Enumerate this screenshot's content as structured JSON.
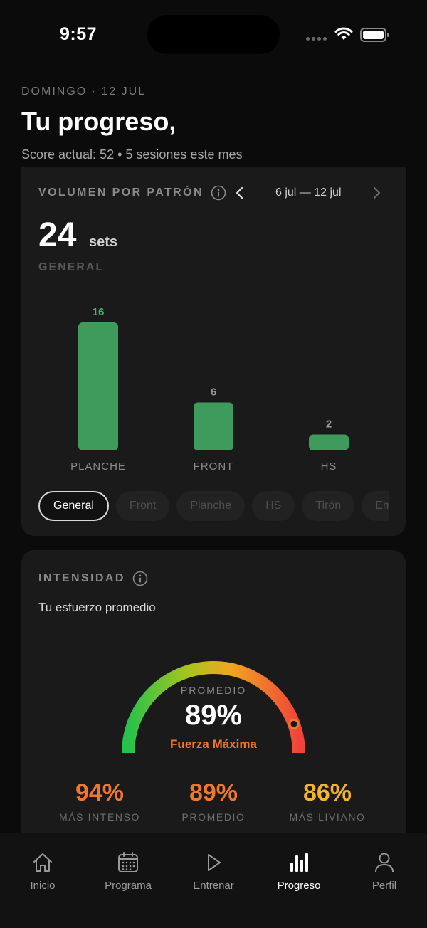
{
  "status_bar": {
    "time": "9:57"
  },
  "header": {
    "date": "DOMINGO · 12 JUL",
    "title": "Tu progreso,",
    "subtitle": "Score actual: 52 • 5 sesiones este mes"
  },
  "volume": {
    "label": "VOLUMEN POR PATRÓN",
    "range": "6 jul — 12 jul",
    "total": "24",
    "unit": "sets",
    "caption": "GENERAL",
    "chips": [
      "General",
      "Front",
      "Planche",
      "HS",
      "Tirón",
      "Em"
    ],
    "active_chip": "General"
  },
  "chart_data": {
    "type": "bar",
    "categories": [
      "PLANCHE",
      "FRONT",
      "HS"
    ],
    "values": [
      16,
      6,
      2
    ],
    "colors": {
      "bar": "#3e9b5c",
      "value_label_max": "#4cb36c",
      "value_label": "#9a9a9a",
      "category_label": "#8a8a8a"
    }
  },
  "intensity": {
    "label": "INTENSIDAD",
    "subtitle": "Tu esfuerzo promedio",
    "gauge_caption": "PROMEDIO",
    "gauge_value": "89%",
    "gauge_level": 0.89,
    "gauge_tag": "Fuerza Máxima",
    "stats": [
      {
        "value": "94%",
        "label": "MÁS INTENSO",
        "color": "#f0772e"
      },
      {
        "value": "89%",
        "label": "PROMEDIO",
        "color": "#f0772e"
      },
      {
        "value": "86%",
        "label": "MÁS LIVIANO",
        "color": "#f2b32f"
      }
    ]
  },
  "tabs": [
    {
      "label": "Inicio",
      "icon": "home-icon"
    },
    {
      "label": "Programa",
      "icon": "calendar-icon"
    },
    {
      "label": "Entrenar",
      "icon": "play-icon"
    },
    {
      "label": "Progreso",
      "icon": "bar-chart-icon",
      "active": true
    },
    {
      "label": "Perfil",
      "icon": "user-icon"
    }
  ]
}
